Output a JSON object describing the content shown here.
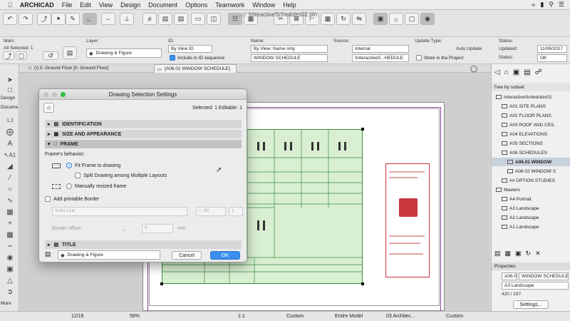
{
  "menubar": {
    "app": "ARCHICAD",
    "items": [
      "File",
      "Edit",
      "View",
      "Design",
      "Document",
      "Options",
      "Teamwork",
      "Window",
      "Help"
    ]
  },
  "document": {
    "title": "InteractiveSchedules01.pln"
  },
  "infobox": {
    "main_label": "Main:",
    "all_selected": "All Selected: 1",
    "layer_label": "Layer:",
    "layer_value": "Drawing & Figure",
    "id_label": "ID:",
    "by_view_id": "By View ID",
    "include_label": "Include in ID sequence",
    "name_label": "Name:",
    "name_mode": "By View: Name only",
    "name_value": "WINDOW SCHEDULE",
    "source_label": "Source:",
    "source_value": "Internal",
    "source_path": "\\InteractiveS...HEDULE",
    "update_label": "Update Type:",
    "update_value": "Auto Update",
    "store_label": "Store in the Project",
    "status_label": "Status:",
    "updated_label": "Updated:",
    "updated_value": "11/06/2017",
    "status2_label": "Status:",
    "status_value": "OK"
  },
  "tabs": {
    "floor": "(!) 0. Ground Floor [0. Ground Floor]",
    "layout": "[A06.01 WINDOW SCHEDULE]"
  },
  "toolbox": {
    "design": "Design",
    "document": "Docume",
    "more": "More"
  },
  "navigator": {
    "tree_mode": "Tree by subset",
    "items": [
      {
        "label": "InteractiveSchedules01",
        "indent": 0
      },
      {
        "label": "A01 SITE PLANS",
        "indent": 1
      },
      {
        "label": "A02 FLOOR PLANS",
        "indent": 1
      },
      {
        "label": "A03 ROOF AND CEIL",
        "indent": 1
      },
      {
        "label": "A04 ELEVATIONS",
        "indent": 1
      },
      {
        "label": "A05 SECTIONS",
        "indent": 1
      },
      {
        "label": "A06 SCHEDULES",
        "indent": 1
      },
      {
        "label": "A06.01 WINDOW",
        "indent": 2,
        "selected": true
      },
      {
        "label": "A06.02 WINDOW S",
        "indent": 2
      },
      {
        "label": "## OPTION STUDIES",
        "indent": 1
      },
      {
        "label": "Masters",
        "indent": 0
      },
      {
        "label": "A4 Portrait",
        "indent": 1
      },
      {
        "label": "A3 Landscape",
        "indent": 1
      },
      {
        "label": "A2 Landscape",
        "indent": 1
      },
      {
        "label": "A1 Landscape",
        "indent": 1
      }
    ],
    "properties_title": "Properties",
    "prop_id": "A06.0",
    "prop_name": "WINDOW SCHEDULE",
    "prop_size": "A3 Landscape",
    "prop_scale": "420 / 297",
    "settings_label": "Settings..."
  },
  "dialog": {
    "title": "Drawing Selection Settings",
    "selected_info": "Selected: 1 Editable: 1",
    "sections": {
      "identification": "IDENTIFICATION",
      "size": "SIZE AND APPEARANCE",
      "frame": "FRAME",
      "title": "TITLE"
    },
    "frame_behavior": "Frame's behavior:",
    "fit_frame": "Fit Frame to drawing",
    "split_drawing": "Split Drawing among Multiple Layouts",
    "manual_frame": "Manually resized frame",
    "add_border": "Add printable Border",
    "line_type": "Solid Line",
    "pen_value": "65",
    "pen_weight": "1",
    "offset_label": "Border offset:",
    "offset_value": "5",
    "offset_unit": "mm",
    "layer_value": "Drawing & Figure",
    "cancel": "Cancel",
    "ok": "OK"
  },
  "statusbar": {
    "page": "12/16",
    "zoom": "58%",
    "scale": "1:1",
    "custom1": "Custom",
    "model": "Entire Model",
    "arch": "03 Architec...",
    "custom2": "Custom"
  },
  "colors": {
    "accent": "#3b8ff0",
    "schedule_fill": "#d8efd2",
    "schedule_line": "#3d8a3d",
    "selection_frame": "#8a3f9a",
    "title_red": "#c9363b"
  }
}
